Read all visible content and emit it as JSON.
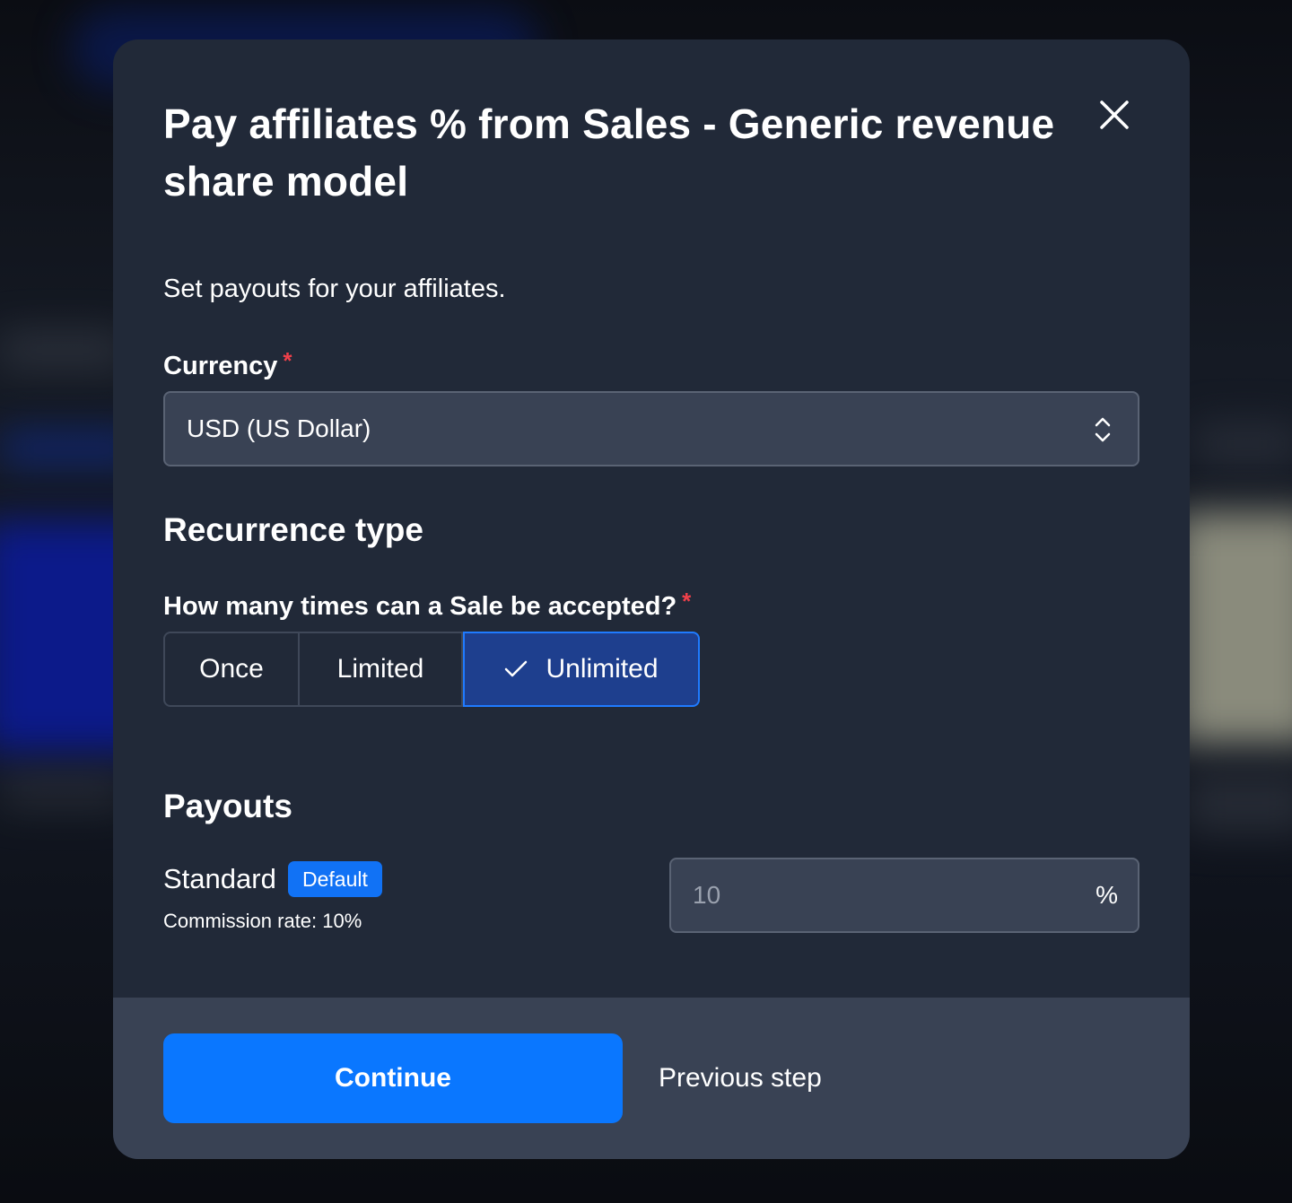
{
  "modal": {
    "title": "Pay affiliates % from Sales - Generic revenue share model",
    "intro": "Set payouts for your affiliates."
  },
  "currency": {
    "label": "Currency",
    "required_marker": "*",
    "selected_value": "USD (US Dollar)"
  },
  "recurrence": {
    "heading": "Recurrence type",
    "question": "How many times can a Sale be accepted?",
    "required_marker": "*",
    "options": [
      "Once",
      "Limited",
      "Unlimited"
    ],
    "selected": "Unlimited"
  },
  "payouts": {
    "heading": "Payouts",
    "items": [
      {
        "name": "Standard",
        "badge": "Default",
        "commission": "Commission rate: 10%",
        "value": "10",
        "suffix": "%"
      }
    ]
  },
  "footer": {
    "continue_label": "Continue",
    "previous_label": "Previous step"
  },
  "colors": {
    "modal_bg": "#212938",
    "footer_bg": "#394254",
    "primary": "#0a77ff",
    "selected_segment_bg": "#1e3f8e",
    "required": "#f0404a"
  },
  "icons": {
    "close": "close-icon",
    "select": "chevron-up-down-icon",
    "check": "check-icon"
  }
}
